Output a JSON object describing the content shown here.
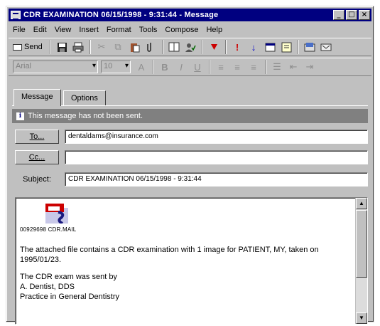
{
  "window": {
    "title": "CDR EXAMINATION 06/15/1998 - 9:31:44 - Message",
    "controls": {
      "minimize": "_",
      "maximize": "□",
      "close": "×"
    }
  },
  "menu": [
    "File",
    "Edit",
    "View",
    "Insert",
    "Format",
    "Tools",
    "Compose",
    "Help"
  ],
  "toolbar": {
    "send_label": "Send",
    "icons": [
      "save-icon",
      "print-icon",
      "cut-icon",
      "copy-icon",
      "paste-icon",
      "attach-icon",
      "address-book-icon",
      "check-names-icon",
      "flag-icon",
      "high-importance-icon",
      "low-importance-icon",
      "properties-icon",
      "options-icon",
      "inbox-icon",
      "help-icon"
    ]
  },
  "format_bar": {
    "font": "Arial",
    "size": "10"
  },
  "tabs": [
    {
      "label": "Message",
      "active": true
    },
    {
      "label": "Options",
      "active": false
    }
  ],
  "info_bar": "This message has not been sent.",
  "fields": {
    "to_label": "To...",
    "to_value": "dentaldams@insurance.com",
    "cc_label": "Cc...",
    "cc_value": "",
    "subject_label": "Subject:",
    "subject_value": "CDR EXAMINATION 06/15/1998 - 9:31:44"
  },
  "body": {
    "attachment_caption": "00929698 CDR.MAIL",
    "paragraph1": "The attached file contains a CDR examination with 1 image for PATIENT, MY, taken on 1995/01/23.",
    "line1": "The CDR exam was sent by",
    "line2": "A. Dentist, DDS",
    "line3": "Practice in General Dentistry"
  },
  "colors": {
    "titlebar": "#000080",
    "face": "#c0c0c0",
    "info": "#808080",
    "red": "#cc0000"
  }
}
